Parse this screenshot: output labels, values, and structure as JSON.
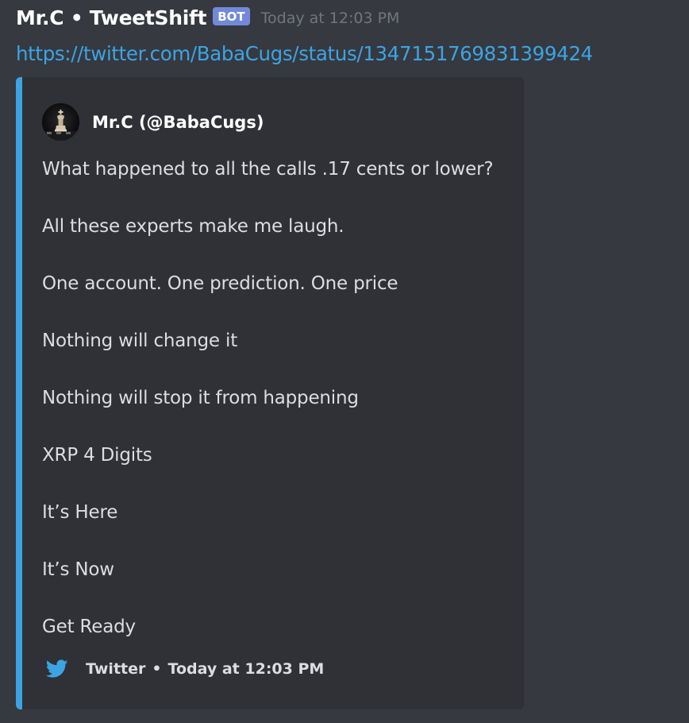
{
  "message": {
    "author": "Mr.C • TweetShift",
    "bot_tag": "BOT",
    "timestamp": "Today at 12:03 PM",
    "link": "https://twitter.com/BabaCugs/status/1347151769831399424"
  },
  "embed": {
    "accent_color": "#3ca4e5",
    "author_name": "Mr.C (@BabaCugs)",
    "avatar_icon": "chess-king-avatar",
    "lines": [
      "What happened to all the calls .17 cents or lower?",
      "All these experts make me laugh.",
      "One account. One prediction. One price",
      "Nothing will change it",
      "Nothing will stop it from happening",
      "XRP 4 Digits",
      "It’s Here",
      "It’s Now",
      "Get Ready"
    ],
    "footer": {
      "icon": "twitter-bird-icon",
      "source": "Twitter",
      "separator": "•",
      "timestamp": "Today at 12:03 PM"
    }
  }
}
